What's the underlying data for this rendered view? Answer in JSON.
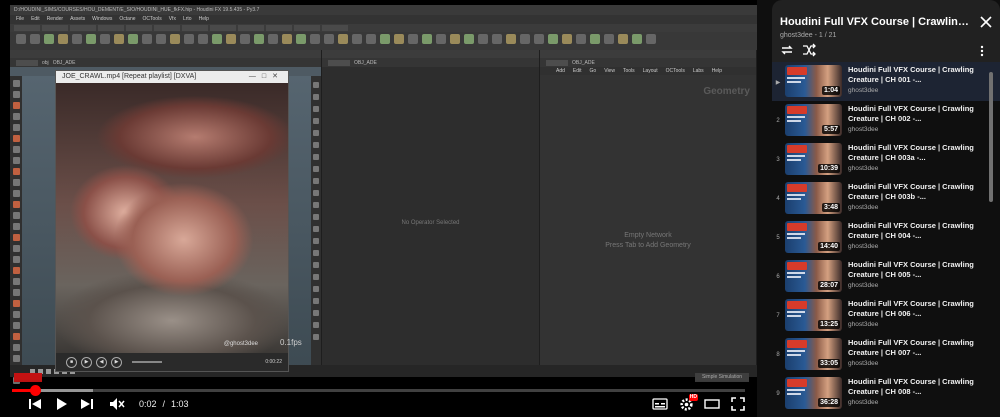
{
  "player": {
    "houdini_title": "D:/HOUDINI_SIMS/COURSES/HOU_DEMENT/E_SIO/HOUDINI_HUE_fkFX.hip - Houdini FX 19.5.435 - Py3.7",
    "houdini_menu": [
      "File",
      "Edit",
      "Render",
      "Assets",
      "Windows",
      "Octane",
      "OCTools",
      "Vfx",
      "Lrto",
      "Help"
    ],
    "network_path": "obj",
    "network_context": "OBJ_ADE",
    "net_menu": [
      "Add",
      "Edit",
      "Go",
      "View",
      "Tools",
      "Layout",
      "OCTools",
      "Labs",
      "Help"
    ],
    "mid_pane_text": "No Operator Selected",
    "net_empty_line1": "Empty Network",
    "net_empty_line2": "Press Tab to Add Geometry",
    "geometry_label": "Geometry",
    "media_window_title": "JOE_CRAWL.mp4 [Repeat playlist] [DXVA]",
    "media_watermark": "@ghost3dee",
    "media_time": "0:00:22",
    "fps_label": "0.1fps",
    "sim_button": "Simple Simulation",
    "time_current": "0:02",
    "time_separator": "/",
    "time_total": "1:03",
    "progress_fraction": 0.032,
    "buffer_fraction": 0.11,
    "hd_badge": "HD",
    "colors": {
      "accent": "#ff0000"
    }
  },
  "sidebar": {
    "title": "Houdini Full VFX Course | Crawling Creature",
    "subtitle": "ghost3dee - 1 / 21",
    "items": [
      {
        "index": "▶",
        "title": "Houdini Full VFX Course | Crawling Creature | CH 001 -...",
        "channel": "ghost3dee",
        "duration": "1:04",
        "active": true
      },
      {
        "index": "2",
        "title": "Houdini Full VFX Course | Crawling Creature | CH 002 -...",
        "channel": "ghost3dee",
        "duration": "5:57"
      },
      {
        "index": "3",
        "title": "Houdini Full VFX Course | Crawling Creature | CH 003a -...",
        "channel": "ghost3dee",
        "duration": "10:39"
      },
      {
        "index": "4",
        "title": "Houdini Full VFX Course | Crawling Creature | CH 003b -...",
        "channel": "ghost3dee",
        "duration": "3:48"
      },
      {
        "index": "5",
        "title": "Houdini Full VFX Course | Crawling Creature | CH 004 -...",
        "channel": "ghost3dee",
        "duration": "14:40"
      },
      {
        "index": "6",
        "title": "Houdini Full VFX Course | Crawling Creature | CH 005 -...",
        "channel": "ghost3dee",
        "duration": "28:07"
      },
      {
        "index": "7",
        "title": "Houdini Full VFX Course | Crawling Creature | CH 006 -...",
        "channel": "ghost3dee",
        "duration": "13:25"
      },
      {
        "index": "8",
        "title": "Houdini Full VFX Course | Crawling Creature | CH 007 -...",
        "channel": "ghost3dee",
        "duration": "33:05"
      },
      {
        "index": "9",
        "title": "Houdini Full VFX Course | Crawling Creature | CH 008 -...",
        "channel": "ghost3dee",
        "duration": "36:28"
      }
    ]
  }
}
